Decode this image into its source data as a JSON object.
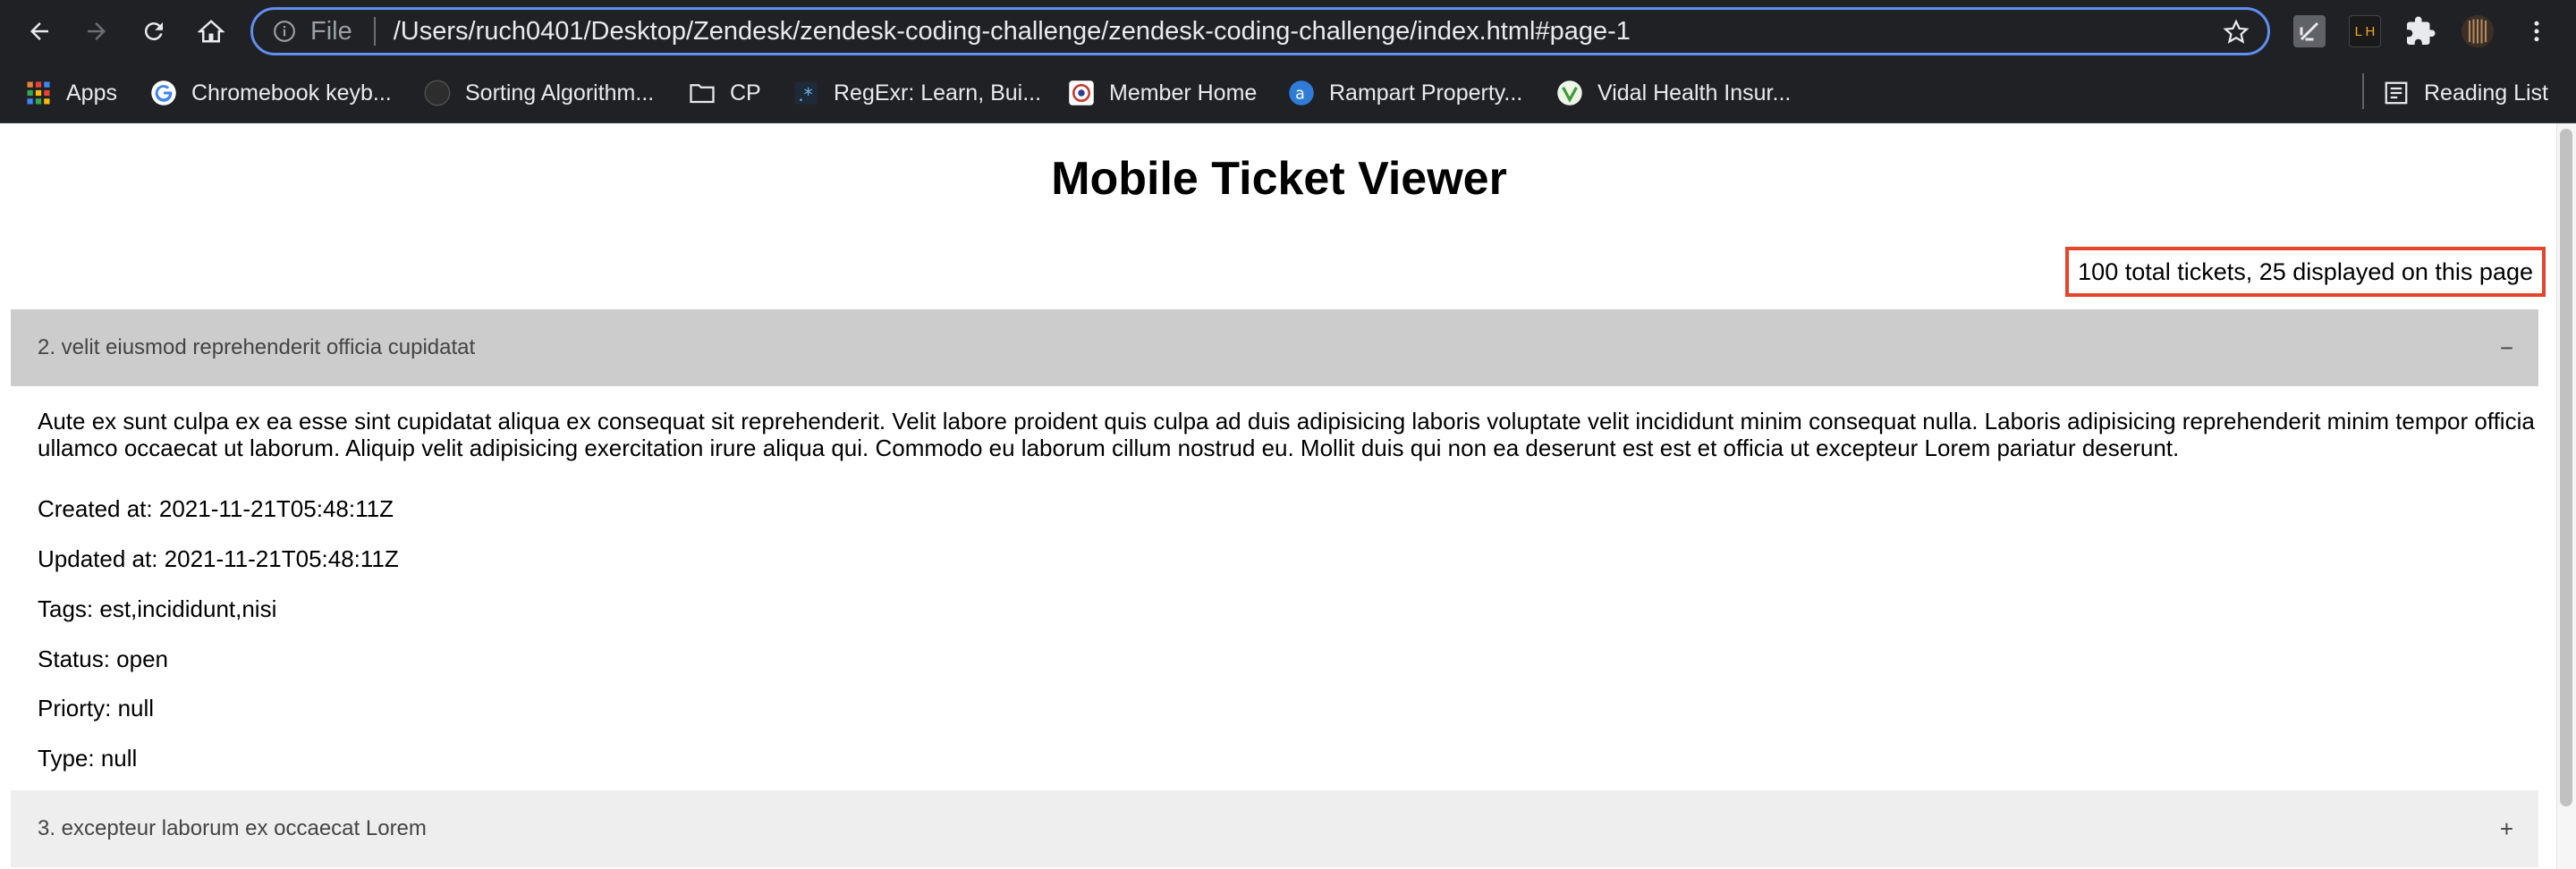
{
  "browser": {
    "scheme_label": "File",
    "url": "/Users/ruch0401/Desktop/Zendesk/zendesk-coding-challenge/zendesk-coding-challenge/index.html#page-1",
    "extension_lh_label": "L H",
    "bookmarks": [
      {
        "label": "Apps",
        "icon": "apps-grid-icon"
      },
      {
        "label": "Chromebook keyb...",
        "icon": "google-icon"
      },
      {
        "label": "Sorting Algorithm...",
        "icon": "site-icon"
      },
      {
        "label": "CP",
        "icon": "folder-icon"
      },
      {
        "label": "RegExr: Learn, Bui...",
        "icon": "regexr-icon"
      },
      {
        "label": "Member Home",
        "icon": "member-icon"
      },
      {
        "label": "Rampart Property...",
        "icon": "rampart-icon"
      },
      {
        "label": "Vidal Health Insur...",
        "icon": "vidal-icon"
      }
    ],
    "reading_list_label": "Reading List"
  },
  "page": {
    "title": "Mobile Ticket Viewer",
    "ticket_count": "100 total tickets, 25 displayed on this page"
  },
  "tickets": [
    {
      "header": "2. velit eiusmod reprehenderit officia cupidatat",
      "toggle": "−",
      "expanded": true,
      "description": "Aute ex sunt culpa ex ea esse sint cupidatat aliqua ex consequat sit reprehenderit. Velit labore proident quis culpa ad duis adipisicing laboris voluptate velit incididunt minim consequat nulla. Laboris adipisicing reprehenderit minim tempor officia ullamco occaecat ut laborum. Aliquip velit adipisicing exercitation irure aliqua qui. Commodo eu laborum cillum nostrud eu. Mollit duis qui non ea deserunt est est et officia ut excepteur Lorem pariatur deserunt.",
      "created": "Created at: 2021-11-21T05:48:11Z",
      "updated": "Updated at: 2021-11-21T05:48:11Z",
      "tags": "Tags: est,incididunt,nisi",
      "status": "Status: open",
      "priority": "Priorty: null",
      "type": "Type: null"
    },
    {
      "header": "3. excepteur laborum ex occaecat Lorem",
      "toggle": "+",
      "expanded": false
    }
  ],
  "colors": {
    "chrome_bg": "#202124",
    "omnibox_focus": "#5f8ff0",
    "highlight_box": "#e3452d",
    "accordion_active": "#cccccc",
    "accordion_inactive": "#eeeeee"
  }
}
